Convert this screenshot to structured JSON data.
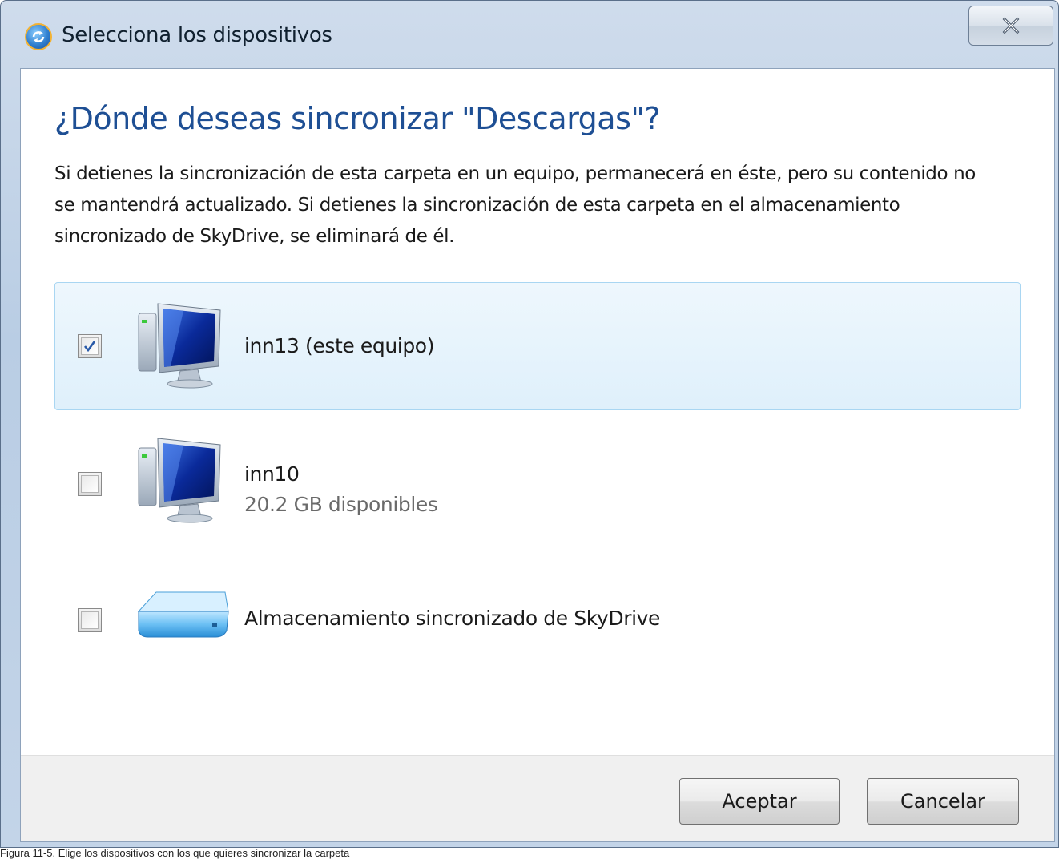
{
  "window": {
    "title": "Selecciona los dispositivos"
  },
  "content": {
    "heading": "¿Dónde deseas sincronizar \"Descargas\"?",
    "description": "Si detienes la sincronización de esta carpeta en un equipo, permanecerá en éste, pero su contenido no se mantendrá actualizado. Si detienes la sincronización de esta carpeta en el almacenamiento sincronizado de SkyDrive, se eliminará de él."
  },
  "devices": [
    {
      "name": "inn13 (este equipo)",
      "subtitle": "",
      "checked": true,
      "selected": true,
      "icon": "computer-monitor-icon"
    },
    {
      "name": "inn10",
      "subtitle": "20.2 GB disponibles",
      "checked": false,
      "selected": false,
      "icon": "computer-monitor-icon"
    },
    {
      "name": "Almacenamiento sincronizado de SkyDrive",
      "subtitle": "",
      "checked": false,
      "selected": false,
      "icon": "cloud-drive-icon"
    }
  ],
  "buttons": {
    "accept": "Aceptar",
    "cancel": "Cancelar"
  },
  "caption": "Figura 11-5. Elige los dispositivos con los que quieres sincronizar la carpeta",
  "colors": {
    "heading": "#1e4f94",
    "selected_row_bg": "#dff0fb",
    "selected_row_border": "#a9d6f2",
    "checkmark": "#2a5aa8"
  }
}
